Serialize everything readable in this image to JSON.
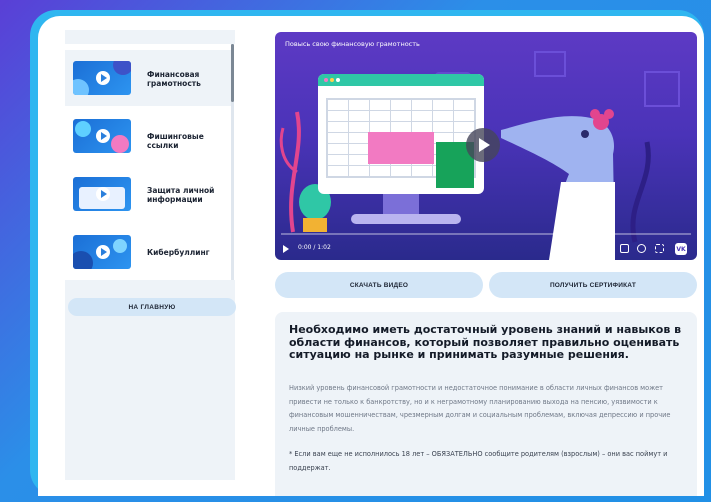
{
  "sidebar": {
    "items": [
      {
        "label": "Финансовая грамотность",
        "active": true
      },
      {
        "label": "Фишинговые ссылки",
        "active": false
      },
      {
        "label": "Защита личной информации",
        "active": false
      },
      {
        "label": "Кибербуллинг",
        "active": false
      }
    ],
    "home_label": "НА ГЛАВНУЮ"
  },
  "video": {
    "title": "Повысь свою финансовую грамотность",
    "time": "0:00 / 1:02",
    "brand": "VK"
  },
  "actions": {
    "download_label": "СКАЧАТЬ ВИДЕО",
    "certificate_label": "ПОЛУЧИТЬ СЕРТИФИКАТ"
  },
  "info": {
    "heading": "Необходимо иметь достаточный уровень знаний и навыков в области финансов, который позволяет правильно оценивать ситуацию на рынке и принимать разумные решения.",
    "body": "Низкий уровень финансовой грамотности и недостаточное понимание в области личных финансов может привести не только к банкротству, но и к неграмотному планированию выхода на пенсию, уязвимости к финансовым мошенничествам, чрезмерным долгам и социальным проблемам, включая депрессию и прочие личные проблемы.",
    "note": "* Если вам еще не исполнилось 18 лет – ОБЯЗАТЕЛЬНО сообщите родителям (взрослым) – они вас поймут и поддержат."
  },
  "colors": {
    "accent": "#2fb6f0",
    "button": "#d3e6f7",
    "video_bg": "#4a33b8"
  }
}
